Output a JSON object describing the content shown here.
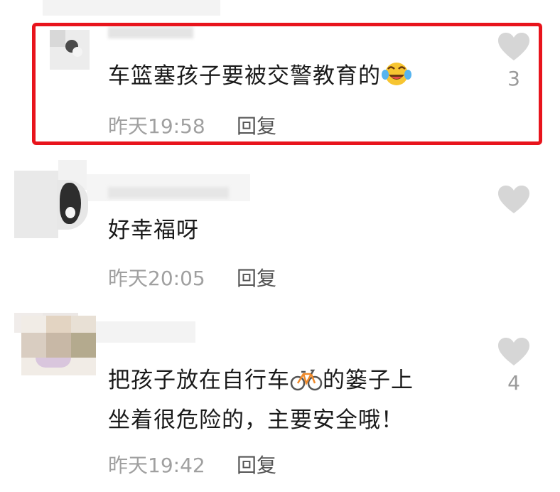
{
  "comments": [
    {
      "text": "车篮塞孩子要被交警教育的",
      "emoji": "crying-laughing-emoji",
      "time": "昨天19:58",
      "reply_label": "回复",
      "like_count": "3",
      "highlighted": true
    },
    {
      "text": "好幸福呀",
      "time": "昨天20:05",
      "reply_label": "回复",
      "like_count": "",
      "highlighted": false
    },
    {
      "line1_before": "把孩子放在自行车",
      "line1_emoji": "bicycle-emoji",
      "line1_after": "的篓子上",
      "line2": "坐着很危险的，主要安全哦！",
      "time": "昨天19:42",
      "reply_label": "回复",
      "like_count": "4",
      "highlighted": false
    }
  ],
  "colors": {
    "highlight": "#e8141c",
    "heart": "#d6d6d6",
    "meta": "#a0a0a0"
  },
  "icons": [
    "heart-icon"
  ]
}
